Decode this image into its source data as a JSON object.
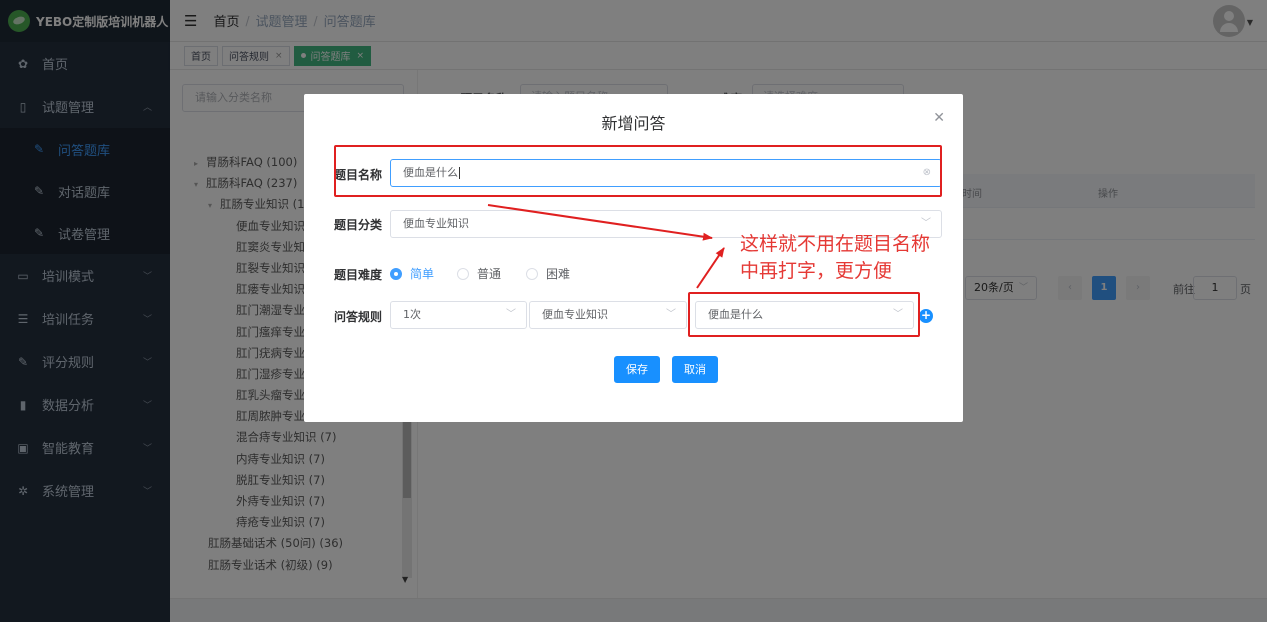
{
  "brand": {
    "name": "YEBO定制版培训机器人"
  },
  "sidebar": {
    "items": [
      {
        "label": "首页",
        "icon": "dashboard-icon",
        "glyph": "✿"
      },
      {
        "label": "试题管理",
        "icon": "book-icon",
        "glyph": "▯"
      },
      {
        "label": "培训模式",
        "icon": "monitor-icon",
        "glyph": "▭"
      },
      {
        "label": "培训任务",
        "icon": "list-icon",
        "glyph": "☰"
      },
      {
        "label": "评分规则",
        "icon": "edit-icon",
        "glyph": "✎"
      },
      {
        "label": "数据分析",
        "icon": "bar-chart-icon",
        "glyph": "▮"
      },
      {
        "label": "智能教育",
        "icon": "screen-icon",
        "glyph": "▣"
      },
      {
        "label": "系统管理",
        "icon": "gear-icon",
        "glyph": "✲"
      }
    ],
    "submenu": [
      {
        "label": "问答题库",
        "active": true
      },
      {
        "label": "对话题库",
        "active": false
      },
      {
        "label": "试卷管理",
        "active": false
      }
    ]
  },
  "header": {
    "breadcrumb": [
      "首页",
      "试题管理",
      "问答题库"
    ]
  },
  "tags": [
    {
      "label": "首页"
    },
    {
      "label": "问答规则"
    },
    {
      "label": "问答题库",
      "active": true
    }
  ],
  "tree": {
    "search_placeholder": "请输入分类名称",
    "rows": [
      {
        "label": "胃肠科FAQ (100)",
        "level": 0,
        "toggle": "▸"
      },
      {
        "label": "肛肠科FAQ (237)",
        "level": 0,
        "toggle": "▾"
      },
      {
        "label": "肛肠专业知识 (1",
        "level": 1,
        "toggle": "▾"
      },
      {
        "label": "便血专业知识",
        "level": 2
      },
      {
        "label": "肛窦炎专业知",
        "level": 2
      },
      {
        "label": "肛裂专业知识",
        "level": 2
      },
      {
        "label": "肛瘘专业知识",
        "level": 2
      },
      {
        "label": "肛门潮湿专业",
        "level": 2
      },
      {
        "label": "肛门瘙痒专业",
        "level": 2
      },
      {
        "label": "肛门疣病专业",
        "level": 2
      },
      {
        "label": "肛门湿疹专业",
        "level": 2
      },
      {
        "label": "肛乳头瘤专业",
        "level": 2
      },
      {
        "label": "肛周脓肿专业",
        "level": 2
      },
      {
        "label": "混合痔专业知识 (7)",
        "level": 2
      },
      {
        "label": "内痔专业知识 (7)",
        "level": 2
      },
      {
        "label": "脱肛专业知识 (7)",
        "level": 2
      },
      {
        "label": "外痔专业知识 (7)",
        "level": 2
      },
      {
        "label": "痔疮专业知识 (7)",
        "level": 2
      },
      {
        "label": "肛肠基础话术 (50问) (36)",
        "level": 1
      },
      {
        "label": "肛肠专业话术 (初级) (9)",
        "level": 1
      }
    ]
  },
  "background": {
    "filter_name_label": "题目名称",
    "filter_name_placeholder": "请输入题目名称",
    "filter_difficulty_label": "难度",
    "filter_difficulty_placeholder": "请选择难度",
    "table_columns": [
      "更新时间",
      "操作"
    ],
    "pager": {
      "page_size": "20条/页",
      "current_page": "1",
      "goto_label": "前往",
      "goto_value": "1",
      "page_unit": "页"
    }
  },
  "dialog": {
    "title": "新增问答",
    "name_label": "题目名称",
    "name_value": "便血是什么",
    "category_label": "题目分类",
    "category_value": "便血专业知识",
    "difficulty_label": "题目难度",
    "difficulty_options": [
      {
        "label": "简单",
        "checked": true
      },
      {
        "label": "普通",
        "checked": false
      },
      {
        "label": "困难",
        "checked": false
      }
    ],
    "rule_label": "问答规则",
    "rule_count": "1次",
    "rule_category": "便血专业知识",
    "rule_question": "便血是什么",
    "save_label": "保存",
    "cancel_label": "取消"
  },
  "annotation": {
    "line1": "这样就不用在题目名称",
    "line2": "中再打字，更方便",
    "color": "#e53935"
  }
}
